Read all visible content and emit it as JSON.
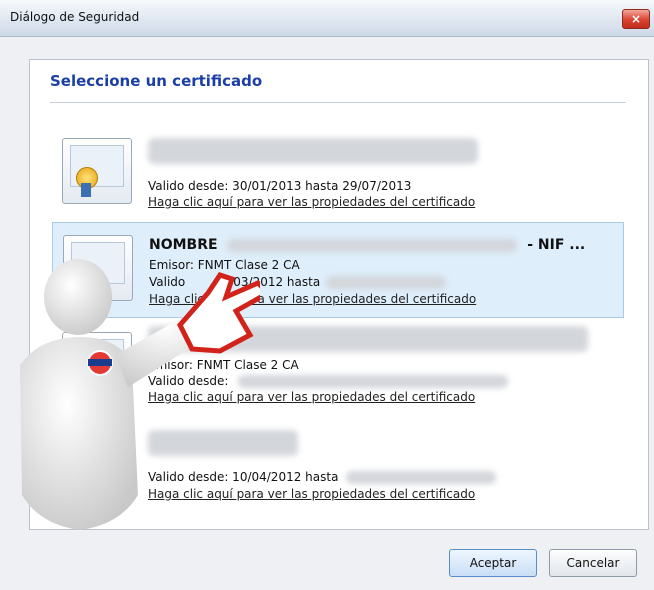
{
  "window": {
    "title": "Diálogo de Seguridad",
    "close": "×"
  },
  "dialog": {
    "heading": "Seleccione un certificado"
  },
  "certificates": [
    {
      "line1": "",
      "line2": "Valido desde: 30/01/2013 hasta 29/07/2013",
      "link": "Haga clic aquí para ver las propiedades del certificado"
    },
    {
      "name_prefix": "NOMBRE",
      "name_suffix": "- NIF ...",
      "issuer": "Emisor: FNMT Clase 2 CA",
      "valid_prefix": "Valido",
      "valid_mid": "03/2012 hasta",
      "link": "Haga clic aquí para ver las propiedades del certificado"
    },
    {
      "issuer": "Emisor: FNMT Clase 2 CA",
      "valid": "Valido desde:",
      "link": "Haga clic aquí para ver las propiedades del certificado"
    },
    {
      "valid": "Valido desde: 10/04/2012 hasta",
      "link": "Haga clic aquí para ver las propiedades del certificado"
    }
  ],
  "buttons": {
    "accept": "Aceptar",
    "cancel": "Cancelar"
  }
}
